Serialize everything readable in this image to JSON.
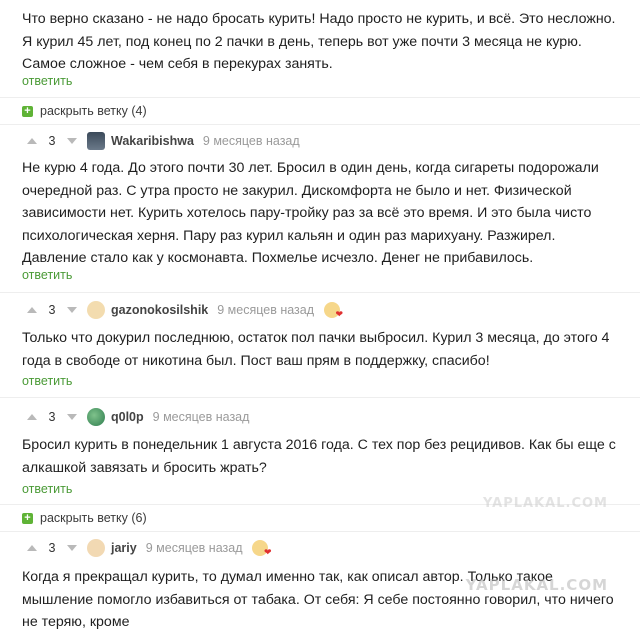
{
  "comments": [
    {
      "text": "Что верно сказано - не надо бросать курить! Надо просто не курить, и всё. Это несложно. Я курил 45 лет, под конец по 2 пачки в день, теперь вот уже почти 3 месяца не курю. Самое сложное - чем себя в перекурах занять.",
      "reply_label": "ответить",
      "expand_label": "раскрыть ветку (4)"
    },
    {
      "rating": "3",
      "author": "Wakaribishwa",
      "time": "9 месяцев назад",
      "text": "Не курю 4 года. До этого почти 30 лет. Бросил в один день, когда сигареты подорожали очередной раз. С утра просто не закурил. Дискомфорта не было и нет. Физической зависимости нет. Курить хотелось пару-тройку раз за всё это время. И это была чисто психологическая херня. Пару раз курил кальян и один раз марихуану. Разжирел. Давление стало как у космонавта. Похмелье исчезло.  Денег не прибавилось.",
      "reply_label": "ответить"
    },
    {
      "rating": "3",
      "author": "gazonokosilshik",
      "time": "9 месяцев назад",
      "text": "Только что докурил последнюю, остаток пол пачки выбросил. Курил 3 месяца, до этого 4 года в свободе от никотина был. Пост ваш прям в поддержку, спасибо!",
      "reply_label": "ответить"
    },
    {
      "rating": "3",
      "author": "q0l0p",
      "time": "9 месяцев назад",
      "text": "Бросил курить в понедельник 1 августа 2016 года. С тех пор без рецидивов. Как бы еще с алкашкой завязать и бросить жрать?",
      "reply_label": "ответить",
      "expand_label": "раскрыть ветку (6)"
    },
    {
      "rating": "3",
      "author": "jariy",
      "time": "9 месяцев назад",
      "text": "Когда я прекращал курить, то думал именно так, как описал автор. Только такое мышление помогло избавиться от табака. От себя: Я себе постоянно говорил, что ничего не теряю, кроме"
    }
  ],
  "watermark_top": "YAPLAKAL.COM",
  "watermark_bottom": "YAPLAKAL.COM",
  "colors": {
    "accent_green": "#4a9a36",
    "plus_green": "#5fb336",
    "heart_red": "#e03030"
  },
  "icons": [
    "upvote-arrow-icon",
    "downvote-arrow-icon",
    "plus-icon",
    "heart-icon"
  ]
}
